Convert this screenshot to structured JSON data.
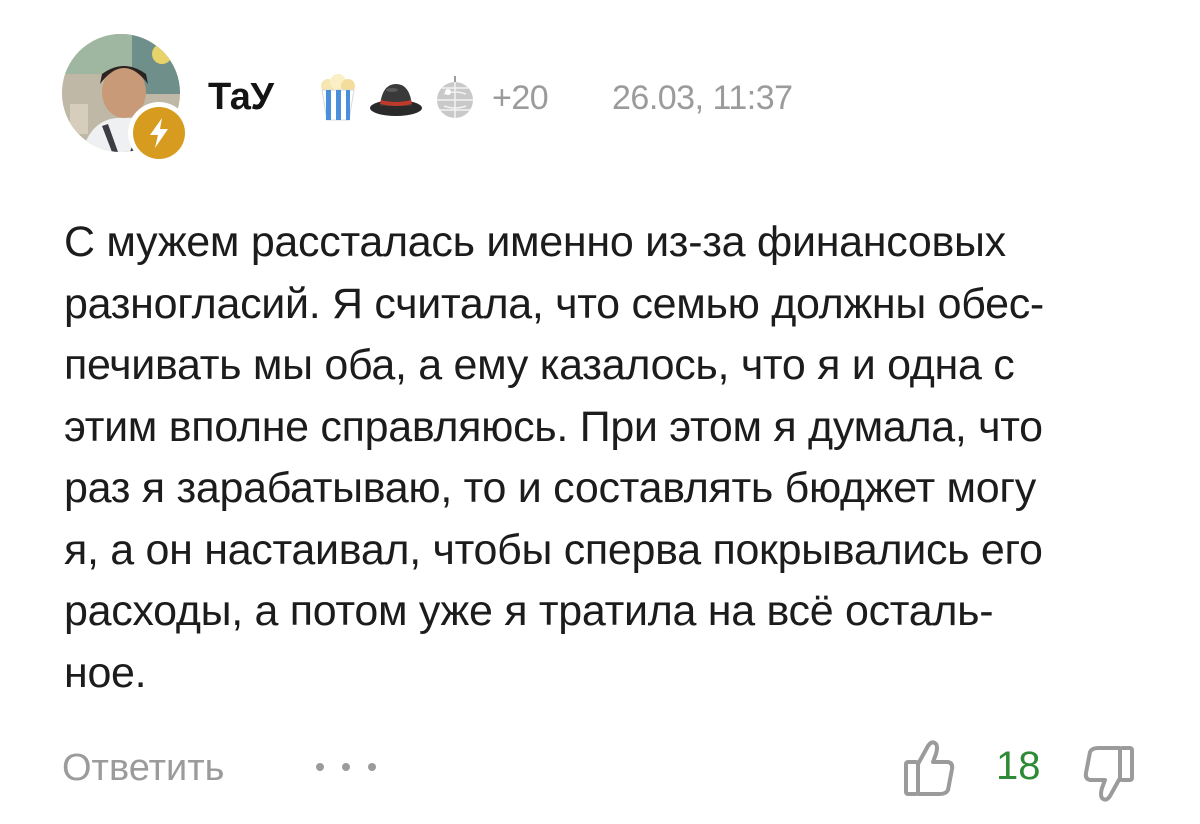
{
  "comment": {
    "author": "ТаУ",
    "extra_badges": "+20",
    "timestamp": "26.03, 11:37",
    "badges": [
      "popcorn-icon",
      "hat-icon",
      "disco-ball-icon"
    ],
    "level_badge_icon": "lightning-icon",
    "text": "С мужем рассталась именно из-за финансовых\nразногласий. Я считала, что семью должны обес-\nпечивать мы оба, а ему казалось, что я и одна с\nэтим вполне справляюсь. При этом я думала, что\nраз я зарабатываю, то и составлять бюджет могу\nя, а он настаивал, чтобы сперва покрывались его\nрасходы, а потом уже я тратила на всё осталь-\nное."
  },
  "actions": {
    "reply_label": "Ответить",
    "more_icon": "more-dots-icon",
    "like_icon": "thumbs-up-icon",
    "like_count": "18",
    "dislike_icon": "thumbs-down-icon"
  },
  "colors": {
    "text": "#1c1c1c",
    "muted": "#9b9b9b",
    "like_count": "#2f8a36",
    "level_badge": "#d79b1f"
  }
}
